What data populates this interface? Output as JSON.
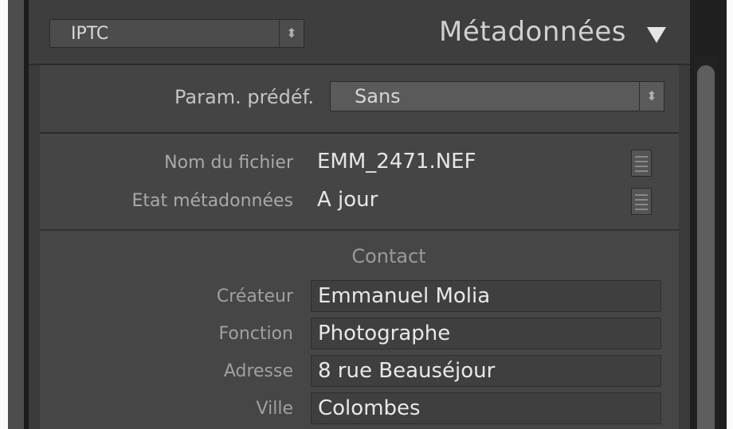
{
  "header": {
    "preset_value": "IPTC",
    "title": "Métadonnées",
    "icons": {
      "select_arrows": "up-down-chevron-icon",
      "collapse": "triangle-down-icon"
    }
  },
  "preset": {
    "label": "Param. prédéf.",
    "value": "Sans"
  },
  "file_info": {
    "rows": [
      {
        "label": "Nom du fichier",
        "value": "EMM_2471.NEF"
      },
      {
        "label": "Etat métadonnées",
        "value": "A jour"
      }
    ]
  },
  "contact": {
    "title": "Contact",
    "fields": [
      {
        "label": "Créateur",
        "value": "Emmanuel Molia"
      },
      {
        "label": "Fonction",
        "value": "Photographe"
      },
      {
        "label": "Adresse",
        "value": "8 rue Beauséjour"
      },
      {
        "label": "Ville",
        "value": "Colombes"
      }
    ]
  },
  "colors": {
    "panel_bg": "#3b3b3b",
    "text_primary": "#e6e6e6",
    "text_label": "#a9a9a9"
  }
}
